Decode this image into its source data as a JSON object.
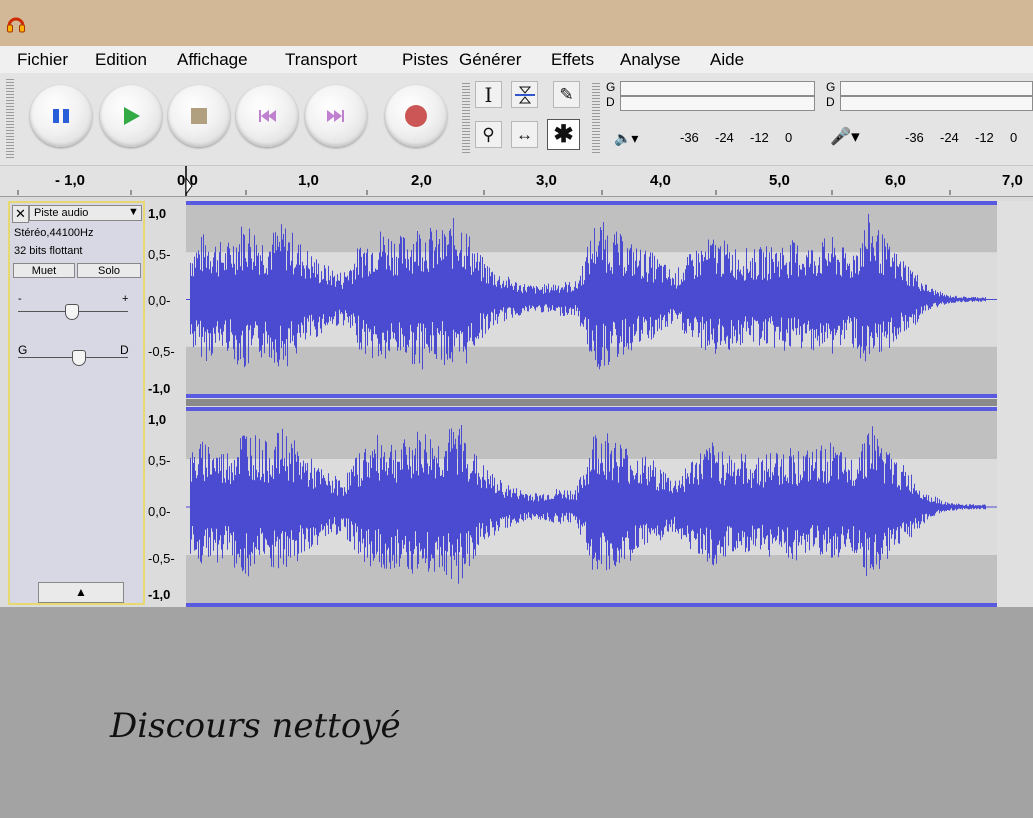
{
  "menu": {
    "items": [
      "Fichier",
      "Edition",
      "Affichage",
      "Transport",
      "Pistes",
      "Générer",
      "Effets",
      "Analyse",
      "Aide"
    ]
  },
  "transport": {
    "buttons": [
      "pause",
      "play",
      "stop",
      "skip-to-start",
      "skip-to-end",
      "record"
    ],
    "colors": {
      "pause": "#2b5fd9",
      "play": "#33aa44",
      "stop": "#b0a080",
      "skip": "#c080d0",
      "record": "#cc5555"
    }
  },
  "tools": {
    "items": [
      "selection",
      "envelope",
      "draw",
      "zoom",
      "time-shift",
      "multi"
    ],
    "active": "multi"
  },
  "meters": {
    "left_letter": "G",
    "right_letter": "D",
    "playback_scale": [
      "-36",
      "-24",
      "-12",
      "0"
    ],
    "record_scale": [
      "-36",
      "-24",
      "-12",
      "0"
    ]
  },
  "ruler": {
    "labels": [
      "- 1,0",
      "0,0",
      "1,0",
      "2,0",
      "3,0",
      "4,0",
      "5,0",
      "6,0",
      "7,0"
    ]
  },
  "track": {
    "name": "Piste audio",
    "format_line": "Stéréo,44100Hz",
    "bits_line": "32 bits flottant",
    "mute_label": "Muet",
    "solo_label": "Solo",
    "gain_minus": "-",
    "gain_plus": "+",
    "pan_left": "G",
    "pan_right": "D",
    "scale_labels": [
      "1,0",
      "0,5-",
      "0,0-",
      "-0,5-",
      "-1,0"
    ]
  },
  "waveform": {
    "color": "#4b4bd1",
    "envelope": [
      0.55,
      0.75,
      0.6,
      0.9,
      0.7,
      0.85,
      0.6,
      0.4,
      0.3,
      0.65,
      0.8,
      0.7,
      0.85,
      0.75,
      0.95,
      0.5,
      0.3,
      0.2,
      0.15,
      0.2,
      0.2,
      0.9,
      0.75,
      0.6,
      0.5,
      0.3,
      0.55,
      0.7,
      0.6,
      0.55,
      0.6,
      0.65,
      0.6,
      0.7,
      0.5,
      0.95,
      0.6,
      0.4,
      0.15,
      0.05,
      0.03,
      0.03
    ]
  },
  "caption": "Discours nettoyé"
}
